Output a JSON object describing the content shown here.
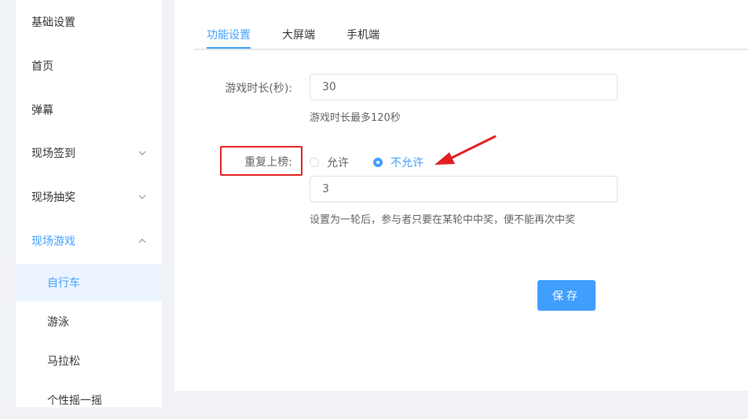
{
  "sidebar": {
    "items": [
      {
        "label": "基础设置"
      },
      {
        "label": "首页"
      },
      {
        "label": "弹幕"
      },
      {
        "label": "现场签到",
        "chevron": "chevron-down"
      },
      {
        "label": "现场抽奖",
        "chevron": "chevron-down"
      },
      {
        "label": "现场游戏",
        "chevron": "chevron-up",
        "expanded": true
      }
    ],
    "sub_items": [
      {
        "label": "自行车",
        "active": true
      },
      {
        "label": "游泳"
      },
      {
        "label": "马拉松"
      },
      {
        "label": "个性摇一摇"
      }
    ]
  },
  "tabs": [
    {
      "label": "功能设置",
      "active": true
    },
    {
      "label": "大屏端"
    },
    {
      "label": "手机端"
    }
  ],
  "form": {
    "duration_label": "游戏时长(秒):",
    "duration_value": "30",
    "duration_hint": "游戏时长最多120秒",
    "repeat_label": "重复上榜:",
    "repeat_options": [
      {
        "label": "允许",
        "checked": false
      },
      {
        "label": "不允许",
        "checked": true
      }
    ],
    "repeat_value": "3",
    "repeat_hint": "设置为一轮后，参与者只要在某轮中中奖，便不能再次中奖",
    "save_label": "保存"
  },
  "colors": {
    "accent": "#409eff",
    "annotation": "#e02020",
    "active_bg": "#ecf5ff"
  }
}
